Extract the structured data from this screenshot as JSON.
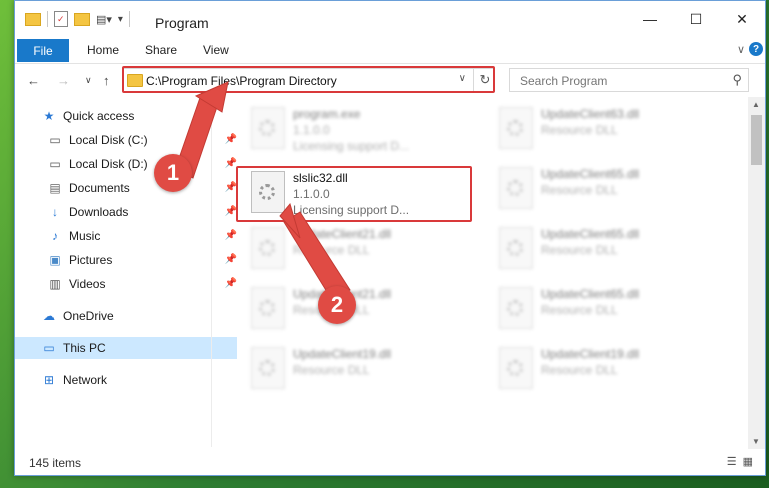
{
  "window": {
    "title": "Program",
    "controls": {
      "minimize": "—",
      "maximize": "☐",
      "close": "✕"
    }
  },
  "ribbon": {
    "tabs": [
      "File",
      "Home",
      "Share",
      "View"
    ],
    "expand": "∨",
    "help": "?"
  },
  "nav": {
    "back": "←",
    "forward": "→",
    "recent": "∨",
    "up": "↑",
    "address": "C:\\Program Files\\Program Directory",
    "search_placeholder": "Search Program"
  },
  "sidebar": {
    "items": [
      {
        "label": "Quick access",
        "icon": "star-icon"
      },
      {
        "label": "Local Disk (C:)",
        "icon": "drive-icon",
        "pinned": true
      },
      {
        "label": "Local Disk (D:)",
        "icon": "drive-icon",
        "pinned": true
      },
      {
        "label": "Documents",
        "icon": "documents-icon",
        "pinned": true
      },
      {
        "label": "Downloads",
        "icon": "downloads-icon",
        "pinned": true
      },
      {
        "label": "Music",
        "icon": "music-icon",
        "pinned": true
      },
      {
        "label": "Pictures",
        "icon": "pictures-icon",
        "pinned": true
      },
      {
        "label": "Videos",
        "icon": "videos-icon",
        "pinned": true
      },
      {
        "label": "OneDrive",
        "icon": "cloud-icon"
      },
      {
        "label": "This PC",
        "icon": "computer-icon",
        "selected": true
      },
      {
        "label": "Network",
        "icon": "network-icon"
      }
    ]
  },
  "files": [
    {
      "name": "program.exe",
      "line1": "1.1.0.0",
      "line2": "Licensing support D...",
      "blurred": true
    },
    {
      "name": "UpdateClient63.dll",
      "line1": "Resource DLL",
      "line2": "",
      "blurred": true
    },
    {
      "name": "slslic32.dll",
      "line1": "1.1.0.0",
      "line2": "Licensing support D...",
      "blurred": false
    },
    {
      "name": "UpdateClient65.dll",
      "line1": "Resource DLL",
      "line2": "",
      "blurred": true
    },
    {
      "name": "UpdateClient21.dll",
      "line1": "Resource DLL",
      "line2": "",
      "blurred": true
    },
    {
      "name": "UpdateClient65.dll",
      "line1": "Resource DLL",
      "line2": "",
      "blurred": true
    },
    {
      "name": "UpdateClient21.dll",
      "line1": "Resource DLL",
      "line2": "",
      "blurred": true
    },
    {
      "name": "UpdateClient65.dll",
      "line1": "Resource DLL",
      "line2": "",
      "blurred": true
    },
    {
      "name": "UpdateClient19.dll",
      "line1": "Resource DLL",
      "line2": "",
      "blurred": true
    },
    {
      "name": "UpdateClient19.dll",
      "line1": "Resource DLL",
      "line2": "",
      "blurred": true
    }
  ],
  "status": {
    "count": "145 items"
  },
  "callouts": [
    "1",
    "2"
  ],
  "colors": {
    "accent": "#1979ca",
    "highlight": "#d9393a",
    "callout": "#e04b44"
  }
}
